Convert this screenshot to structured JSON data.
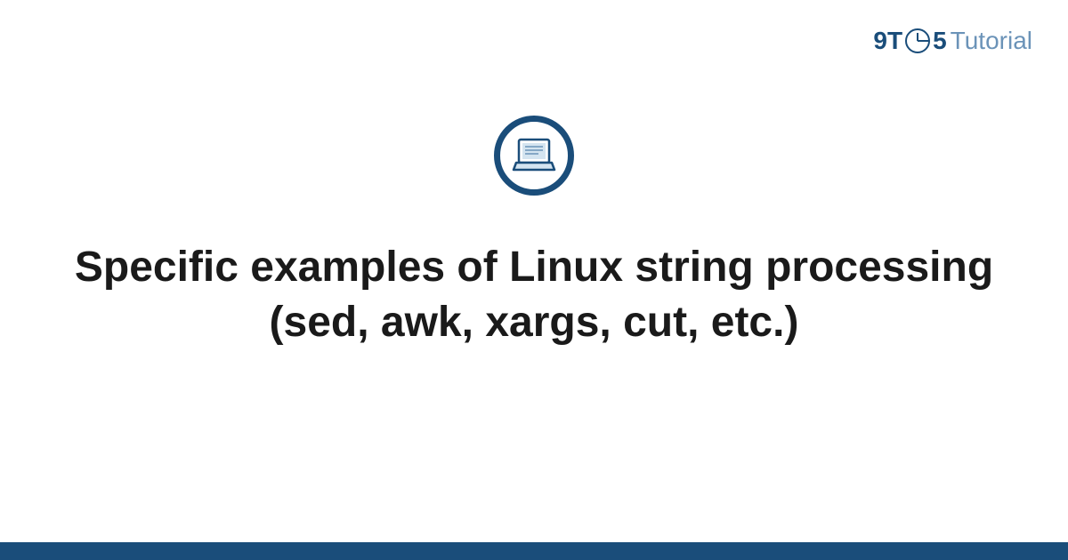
{
  "logo": {
    "prefix": "9T",
    "middle": "5",
    "suffix": "Tutorial"
  },
  "title": "Specific examples of Linux string processing (sed, awk, xargs, cut, etc.)",
  "colors": {
    "primary": "#1a4d7a",
    "secondary": "#6b93b8",
    "text": "#1a1a1a"
  }
}
